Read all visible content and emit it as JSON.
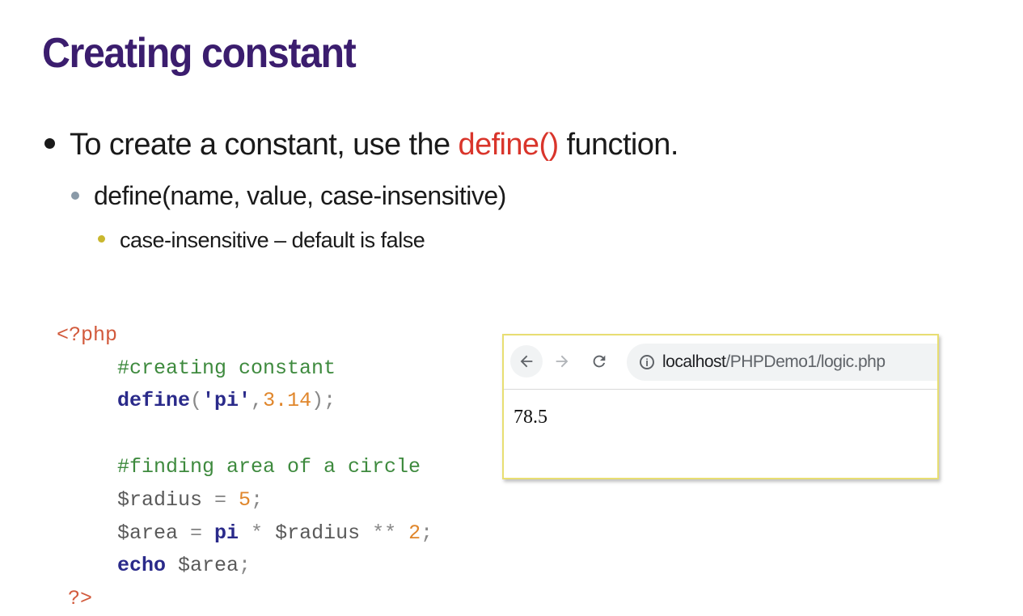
{
  "slide": {
    "title": "Creating constant"
  },
  "bullets": {
    "level1_prefix": "To create a constant, use the ",
    "level1_function": "define()",
    "level1_suffix": " function.",
    "level2": "define(name, value, case-insensitive)",
    "level3": "case-insensitive – default is false"
  },
  "code": {
    "open_tag": "<?php",
    "comment1": "#creating constant",
    "define_kw": "define",
    "define_open": "(",
    "define_str": "'pi'",
    "define_comma": ",",
    "define_num": "3.14",
    "define_close": ");",
    "comment2": "#finding area of a circle",
    "radius_var": "$radius",
    "radius_eq": " = ",
    "radius_num": "5",
    "radius_end": ";",
    "area_var": "$area",
    "area_eq": " = ",
    "area_pi": "pi",
    "area_mul": " * ",
    "area_radius": "$radius",
    "area_pow": " ** ",
    "area_num": "2",
    "area_end": ";",
    "echo_kw": "echo",
    "echo_var": " $area",
    "echo_end": ";",
    "close_tag": "?>"
  },
  "browser": {
    "back_icon": "arrow-left-icon",
    "forward_icon": "arrow-right-icon",
    "reload_icon": "reload-icon",
    "url_host": "localhost",
    "url_path": "/PHPDemo1/logic.php",
    "output": "78.5"
  }
}
